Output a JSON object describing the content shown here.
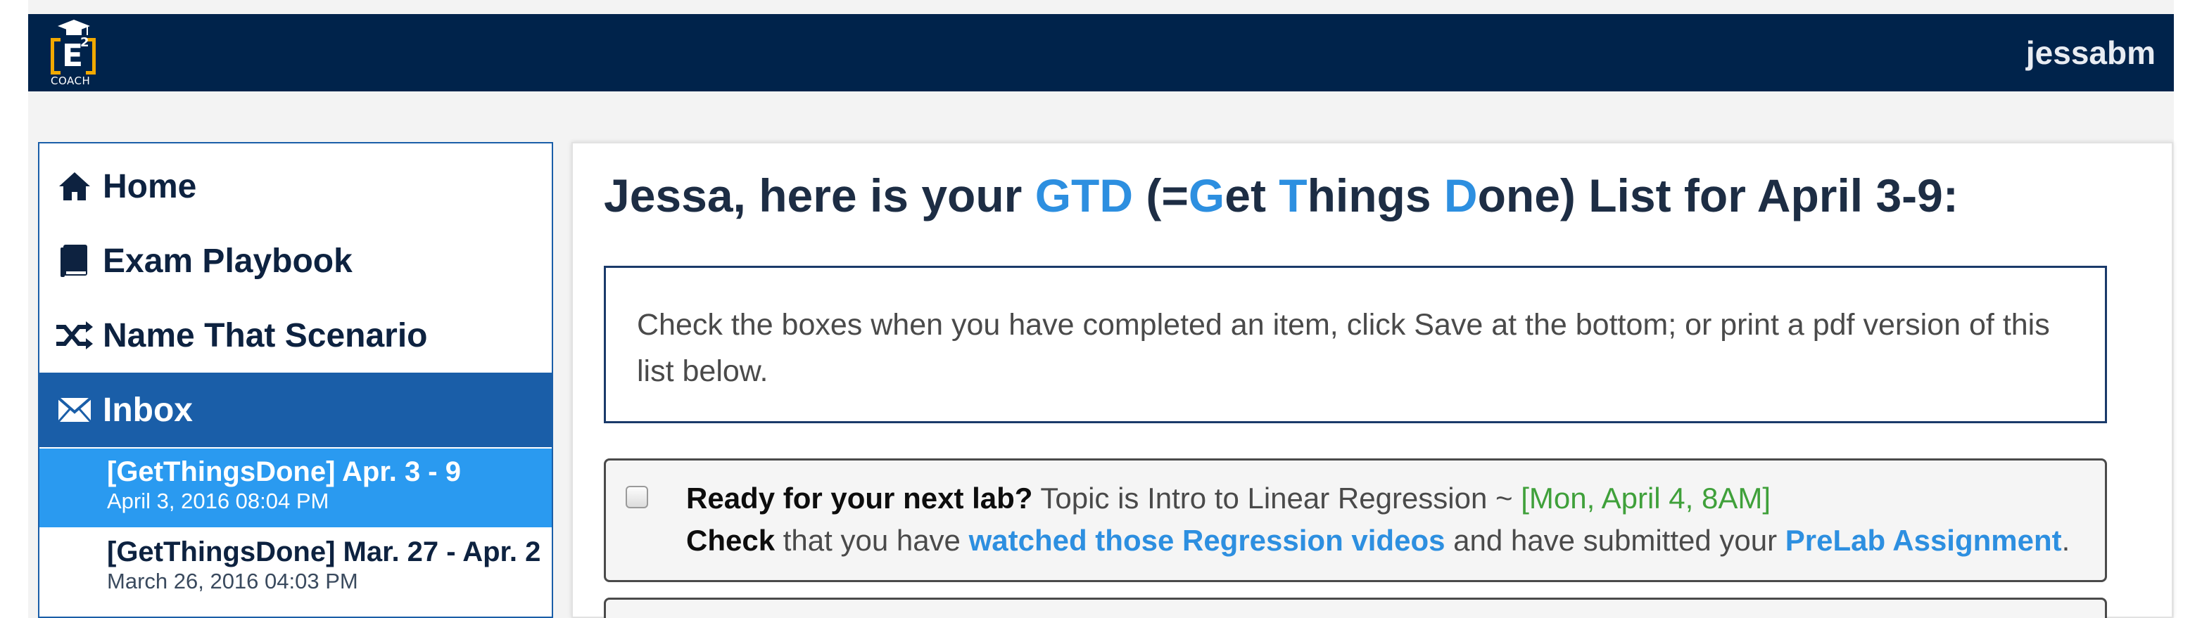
{
  "header": {
    "logo": {
      "letter": "E",
      "superscript": "2",
      "caption": "COACH"
    },
    "username": "jessabm"
  },
  "sidebar": {
    "items": [
      {
        "label": "Home",
        "icon": "home-icon"
      },
      {
        "label": "Exam Playbook",
        "icon": "book-icon"
      },
      {
        "label": "Name That Scenario",
        "icon": "shuffle-icon"
      },
      {
        "label": "Inbox",
        "icon": "envelope-icon",
        "active": true
      }
    ],
    "messages": [
      {
        "subject": "[GetThingsDone] Apr. 3 - 9",
        "date": "April 3, 2016 08:04 PM",
        "active": true
      },
      {
        "subject": "[GetThingsDone] Mar. 27 - Apr. 2",
        "date": "March 26, 2016 04:03 PM",
        "active": false
      }
    ]
  },
  "main": {
    "heading": {
      "p1": "Jessa, here is your ",
      "gtd": "GTD",
      "p2": " (=",
      "g": "G",
      "p3": "et ",
      "t": "T",
      "p4": "hings ",
      "d": "D",
      "p5": "one) List for April 3-9:"
    },
    "instructions": "Check the boxes when you have completed an item, click Save at the bottom; or print a pdf version of this list below.",
    "tasks": [
      {
        "title": "Ready for your next lab?",
        "topic": " Topic is Intro to Linear Regression ~ ",
        "due": "[Mon, April 4, 8AM]",
        "check_label": "Check",
        "text1": " that you have ",
        "link1": "watched those Regression videos",
        "text2": " and have submitted your ",
        "link2": "PreLab Assignment",
        "text3": "."
      }
    ]
  },
  "colors": {
    "navbar": "#00234b",
    "accent": "#2d8fe0",
    "sidebar_active": "#1a5ea8",
    "message_active": "#2a9af0",
    "due_green": "#3fa03a",
    "logo_gold": "#f2a900"
  }
}
